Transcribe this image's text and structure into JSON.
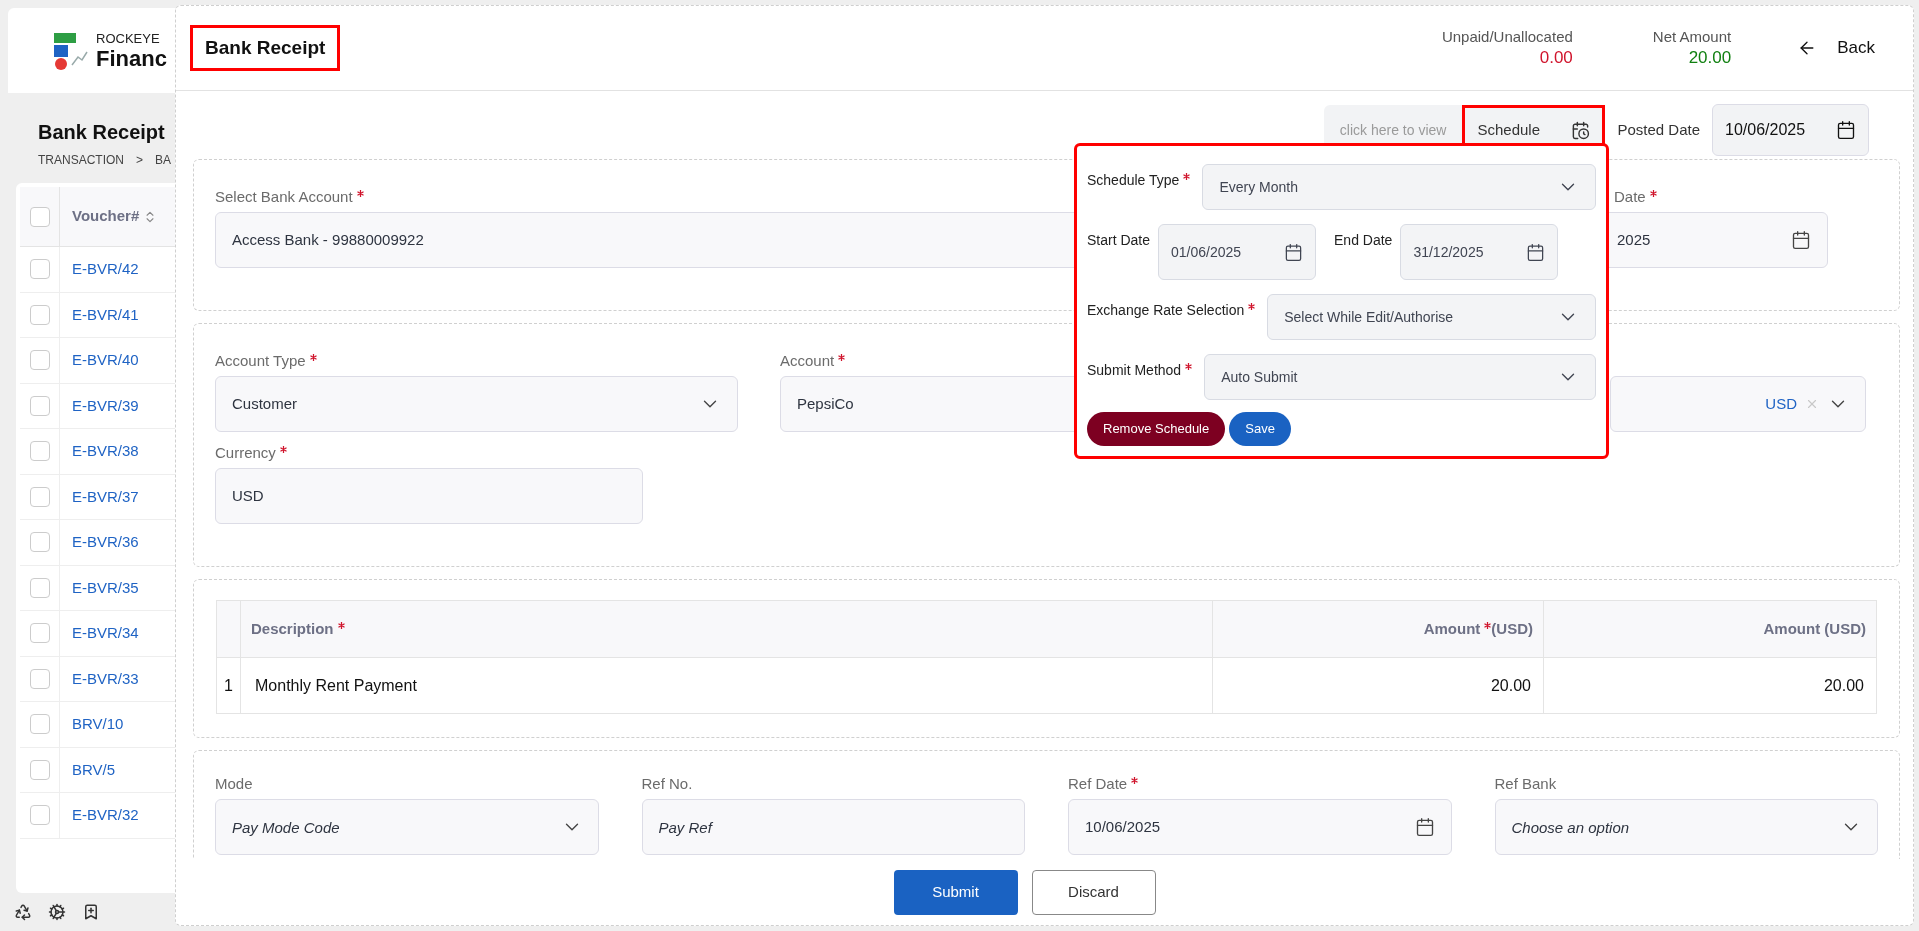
{
  "sidebar": {
    "brand": {
      "line1": "ROCKEYE",
      "line2": "Financ"
    },
    "page_title": "Bank Receipt",
    "breadcrumb": [
      "TRANSACTION",
      ">",
      "BA"
    ],
    "table": {
      "column": "Voucher#",
      "header_checked": false,
      "rows": [
        {
          "voucher": "E-BVR/42",
          "checked": false
        },
        {
          "voucher": "E-BVR/41",
          "checked": false
        },
        {
          "voucher": "E-BVR/40",
          "checked": false
        },
        {
          "voucher": "E-BVR/39",
          "checked": false
        },
        {
          "voucher": "E-BVR/38",
          "checked": false
        },
        {
          "voucher": "E-BVR/37",
          "checked": false
        },
        {
          "voucher": "E-BVR/36",
          "checked": false
        },
        {
          "voucher": "E-BVR/35",
          "checked": false
        },
        {
          "voucher": "E-BVR/34",
          "checked": false
        },
        {
          "voucher": "E-BVR/33",
          "checked": false
        },
        {
          "voucher": "BRV/10",
          "checked": false
        },
        {
          "voucher": "BRV/5",
          "checked": false
        },
        {
          "voucher": "E-BVR/32",
          "checked": false
        }
      ]
    }
  },
  "modal": {
    "title": "Bank Receipt",
    "title_highlighted": true,
    "summary": [
      {
        "label": "Unpaid/Unallocated",
        "value": "0.00",
        "color": "#d0142c"
      },
      {
        "label": "Net Amount",
        "value": "20.00",
        "color": "#118011"
      }
    ],
    "back": "Back"
  },
  "schedule_bar": {
    "hint": "click here to view",
    "button": "Schedule",
    "highlighted": true,
    "posted_date_label": "Posted Date",
    "posted_date": "10/06/2025"
  },
  "schedule_popup": {
    "highlighted": true,
    "rows": [
      {
        "kind": "select",
        "label": "Schedule Type",
        "required": true,
        "value": "Every Month"
      },
      {
        "kind": "dates",
        "items": [
          {
            "label": "Start Date",
            "value": "01/06/2025"
          },
          {
            "label": "End Date",
            "value": "31/12/2025"
          }
        ]
      },
      {
        "kind": "select",
        "label": "Exchange Rate Selection",
        "required": true,
        "value": "Select While Edit/Authorise"
      },
      {
        "kind": "select",
        "label": "Submit Method",
        "required": true,
        "value": "Auto Submit"
      }
    ],
    "buttons": [
      {
        "label": "Remove Schedule",
        "kind": "danger"
      },
      {
        "label": "Save",
        "kind": "primary"
      }
    ]
  },
  "bank_section": {
    "fields": [
      {
        "kind": "text",
        "label": "Select Bank Account",
        "required": true,
        "value": "Access Bank - 99880009922"
      },
      {
        "kind": "date",
        "label": "Date",
        "required": true,
        "value": "2025"
      }
    ]
  },
  "account_section": {
    "fields": [
      {
        "kind": "select",
        "label": "Account Type",
        "required": true,
        "value": "Customer"
      },
      {
        "kind": "text",
        "label": "Account",
        "required": true,
        "value": "PepsiCo"
      },
      {
        "kind": "clearable",
        "value": "USD"
      },
      {
        "kind": "text",
        "label": "Currency",
        "required": true,
        "value": "USD"
      }
    ]
  },
  "lines": {
    "columns": [
      {
        "label": "Description",
        "required": true
      },
      {
        "label": "Amount",
        "required": true,
        "suffix": "(USD)"
      },
      {
        "label": "Amount (USD)"
      }
    ],
    "rows": [
      {
        "index": "1",
        "description": "Monthly Rent Payment",
        "amount": "20.00",
        "amount_base": "20.00"
      }
    ]
  },
  "payment": {
    "fields": [
      {
        "kind": "select",
        "label": "Mode",
        "placeholder": "Pay Mode Code"
      },
      {
        "kind": "text",
        "label": "Ref No.",
        "placeholder": "Pay Ref"
      },
      {
        "kind": "date",
        "label": "Ref Date",
        "required": true,
        "value": "10/06/2025"
      },
      {
        "kind": "select",
        "label": "Ref Bank",
        "placeholder": "Choose an option"
      }
    ]
  },
  "footer": {
    "buttons": [
      {
        "label": "Submit",
        "kind": "primary"
      },
      {
        "label": "Discard",
        "kind": "secondary"
      }
    ]
  }
}
